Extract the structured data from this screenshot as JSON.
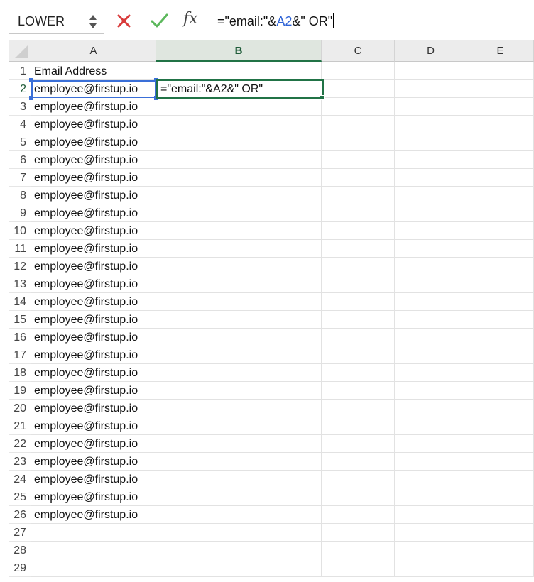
{
  "formula_bar": {
    "name_box": "LOWER",
    "fx_label": "fx",
    "formula_prefix": "=\"email:\"&",
    "formula_ref": "A2",
    "formula_suffix": "&\" OR\""
  },
  "columns": [
    "A",
    "B",
    "C",
    "D",
    "E"
  ],
  "active_column": "B",
  "active_row": 2,
  "rows": [
    {
      "n": "1",
      "a": "Email Address"
    },
    {
      "n": "2",
      "a": "employee@firstup.io"
    },
    {
      "n": "3",
      "a": "employee@firstup.io"
    },
    {
      "n": "4",
      "a": "employee@firstup.io"
    },
    {
      "n": "5",
      "a": "employee@firstup.io"
    },
    {
      "n": "6",
      "a": "employee@firstup.io"
    },
    {
      "n": "7",
      "a": "employee@firstup.io"
    },
    {
      "n": "8",
      "a": "employee@firstup.io"
    },
    {
      "n": "9",
      "a": "employee@firstup.io"
    },
    {
      "n": "10",
      "a": "employee@firstup.io"
    },
    {
      "n": "11",
      "a": "employee@firstup.io"
    },
    {
      "n": "12",
      "a": "employee@firstup.io"
    },
    {
      "n": "13",
      "a": "employee@firstup.io"
    },
    {
      "n": "14",
      "a": "employee@firstup.io"
    },
    {
      "n": "15",
      "a": "employee@firstup.io"
    },
    {
      "n": "16",
      "a": "employee@firstup.io"
    },
    {
      "n": "17",
      "a": "employee@firstup.io"
    },
    {
      "n": "18",
      "a": "employee@firstup.io"
    },
    {
      "n": "19",
      "a": "employee@firstup.io"
    },
    {
      "n": "20",
      "a": "employee@firstup.io"
    },
    {
      "n": "21",
      "a": "employee@firstup.io"
    },
    {
      "n": "22",
      "a": "employee@firstup.io"
    },
    {
      "n": "23",
      "a": "employee@firstup.io"
    },
    {
      "n": "24",
      "a": "employee@firstup.io"
    },
    {
      "n": "25",
      "a": "employee@firstup.io"
    },
    {
      "n": "26",
      "a": "employee@firstup.io"
    },
    {
      "n": "27",
      "a": ""
    },
    {
      "n": "28",
      "a": ""
    },
    {
      "n": "29",
      "a": ""
    }
  ],
  "cell_b2": "=\"email:\"&A2&\" OR\"",
  "colors": {
    "accent_green": "#217346",
    "reference_blue": "#3a6fd8",
    "cancel_red": "#d93b3b",
    "confirm_green": "#5cb85c"
  },
  "icons": {
    "cancel": "close-icon",
    "confirm": "checkmark-icon",
    "function": "function-fx-icon",
    "stepper": "stepper-icon"
  }
}
